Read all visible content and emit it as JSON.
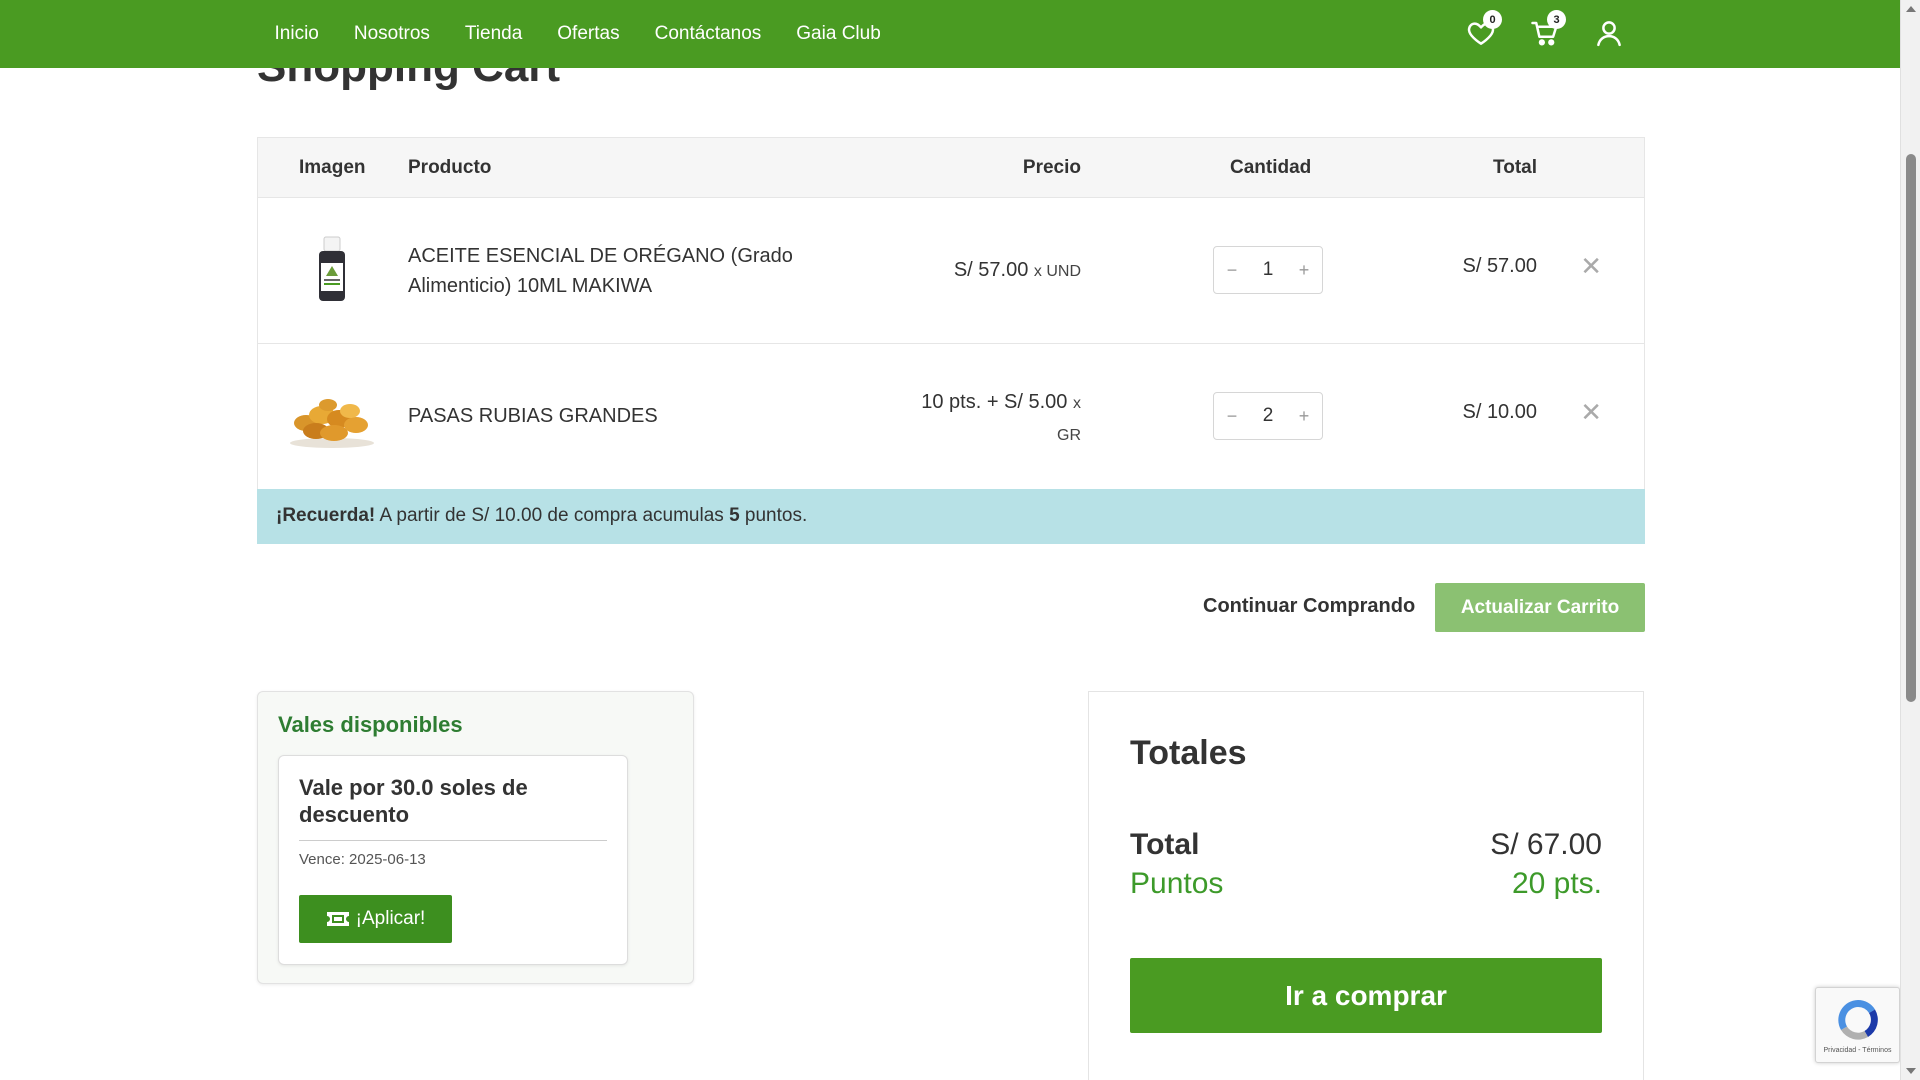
{
  "nav": {
    "items": [
      "Inicio",
      "Nosotros",
      "Tienda",
      "Ofertas",
      "Contáctanos",
      "Gaia Club"
    ],
    "wishlist_count": "0",
    "cart_count": "3"
  },
  "page_title": "Shopping Cart",
  "table": {
    "headers": {
      "image": "Imagen",
      "product": "Producto",
      "price": "Precio",
      "quantity": "Cantidad",
      "total": "Total"
    },
    "rows": [
      {
        "name": "ACEITE ESENCIAL DE ORÉGANO (Grado Alimenticio) 10ML MAKIWA",
        "price": "S/ 57.00",
        "unit": "x UND",
        "qty": "1",
        "total": "S/ 57.00",
        "image_icon": "essential-oil-bottle-icon"
      },
      {
        "name": "PASAS RUBIAS GRANDES",
        "price": "10 pts. + S/ 5.00",
        "unit_x": "x",
        "unit": "GR",
        "qty": "2",
        "total": "S/ 10.00",
        "image_icon": "golden-raisins-icon"
      }
    ],
    "remove_symbol": "✕",
    "minus": "−",
    "plus": "+"
  },
  "notice": {
    "strong": "¡Recuerda!",
    "text_before": " A partir de S/ 10.00 de compra acumulas ",
    "points": "5",
    "text_after": " puntos."
  },
  "actions": {
    "continue": "Continuar Comprando",
    "update": "Actualizar Carrito"
  },
  "vouchers": {
    "title": "Vales disponibles",
    "card_title": "Vale por 30.0 soles de descuento",
    "expires": "Vence: 2025-06-13",
    "apply": "¡Aplicar!"
  },
  "totals": {
    "title": "Totales",
    "total_label": "Total",
    "total_value": "S/ 67.00",
    "points_label": "Puntos",
    "points_value": "20 pts.",
    "buy": "Ir a comprar"
  },
  "recaptcha": {
    "links": "Privacidad - Términos"
  },
  "colors": {
    "brand_green": "#4a9b22",
    "light_green": "#8bc172",
    "notice_bg": "#b7e1e6",
    "points_green": "#3d9a2a"
  }
}
